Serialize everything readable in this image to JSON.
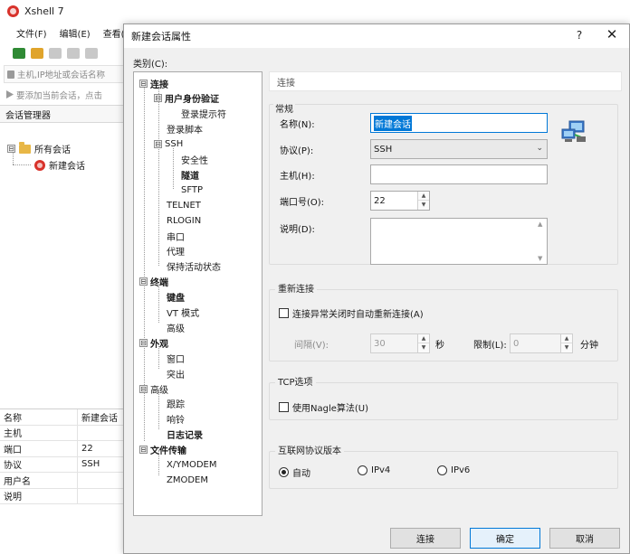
{
  "app": {
    "title": "Xshell 7",
    "menu": [
      "文件(F)",
      "编辑(E)",
      "查看(V"
    ],
    "address_placeholder": "主机,IP地址或会话名称",
    "hint": "要添加当前会话，点击",
    "session_manager": {
      "title": "会话管理器",
      "tree": {
        "root": "所有会话",
        "child": "新建会话",
        "root_expander": "⊟"
      }
    },
    "properties": [
      {
        "key": "名称",
        "value": "新建会话"
      },
      {
        "key": "主机",
        "value": ""
      },
      {
        "key": "端口",
        "value": "22"
      },
      {
        "key": "协议",
        "value": "SSH"
      },
      {
        "key": "用户名",
        "value": ""
      },
      {
        "key": "说明",
        "value": ""
      }
    ]
  },
  "dialog": {
    "title": "新建会话属性",
    "help": "?",
    "close": "✕",
    "category_label": "类别(C):",
    "tree": [
      {
        "label": "连接",
        "bold": true,
        "exp": "⊟"
      },
      {
        "label": "用户身份验证",
        "bold": true,
        "exp": "⊟"
      },
      {
        "label": "登录提示符",
        "bold": false,
        "exp": ""
      },
      {
        "label": "登录脚本",
        "bold": false,
        "exp": ""
      },
      {
        "label": "SSH",
        "bold": false,
        "exp": "⊟"
      },
      {
        "label": "安全性",
        "bold": false,
        "exp": ""
      },
      {
        "label": "隧道",
        "bold": true,
        "exp": ""
      },
      {
        "label": "SFTP",
        "bold": false,
        "exp": ""
      },
      {
        "label": "TELNET",
        "bold": false,
        "exp": ""
      },
      {
        "label": "RLOGIN",
        "bold": false,
        "exp": ""
      },
      {
        "label": "串口",
        "bold": false,
        "exp": ""
      },
      {
        "label": "代理",
        "bold": false,
        "exp": ""
      },
      {
        "label": "保持活动状态",
        "bold": false,
        "exp": ""
      },
      {
        "label": "终端",
        "bold": true,
        "exp": "⊟"
      },
      {
        "label": "键盘",
        "bold": true,
        "exp": ""
      },
      {
        "label": "VT 模式",
        "bold": false,
        "exp": ""
      },
      {
        "label": "高级",
        "bold": false,
        "exp": ""
      },
      {
        "label": "外观",
        "bold": true,
        "exp": "⊟"
      },
      {
        "label": "窗口",
        "bold": false,
        "exp": ""
      },
      {
        "label": "突出",
        "bold": false,
        "exp": ""
      },
      {
        "label": "高级",
        "bold": false,
        "exp": "⊟"
      },
      {
        "label": "跟踪",
        "bold": false,
        "exp": ""
      },
      {
        "label": "响铃",
        "bold": false,
        "exp": ""
      },
      {
        "label": "日志记录",
        "bold": true,
        "exp": ""
      },
      {
        "label": "文件传输",
        "bold": true,
        "exp": "⊟"
      },
      {
        "label": "X/YMODEM",
        "bold": false,
        "exp": ""
      },
      {
        "label": "ZMODEM",
        "bold": false,
        "exp": ""
      }
    ],
    "panel_title": "连接",
    "general": {
      "title": "常规",
      "name_label": "名称(N):",
      "name_value": "新建会话",
      "protocol_label": "协议(P):",
      "protocol_value": "SSH",
      "host_label": "主机(H):",
      "host_value": "",
      "port_label": "端口号(O):",
      "port_value": "22",
      "desc_label": "说明(D):"
    },
    "reconnect": {
      "title": "重新连接",
      "checkbox_label": "连接异常关闭时自动重新连接(A)",
      "interval_label": "间隔(V):",
      "interval_value": "30",
      "interval_unit": "秒",
      "limit_label": "限制(L):",
      "limit_value": "0",
      "limit_unit": "分钟"
    },
    "tcp": {
      "title": "TCP选项",
      "nagle_label": "使用Nagle算法(U)"
    },
    "ip_version": {
      "title": "互联网协议版本",
      "options": [
        "自动",
        "IPv4",
        "IPv6"
      ],
      "selected": "自动"
    },
    "buttons": {
      "connect": "连接",
      "ok": "确定",
      "cancel": "取消"
    },
    "spin_up": "▲",
    "spin_down": "▼",
    "combo_chevron": "⌄"
  }
}
